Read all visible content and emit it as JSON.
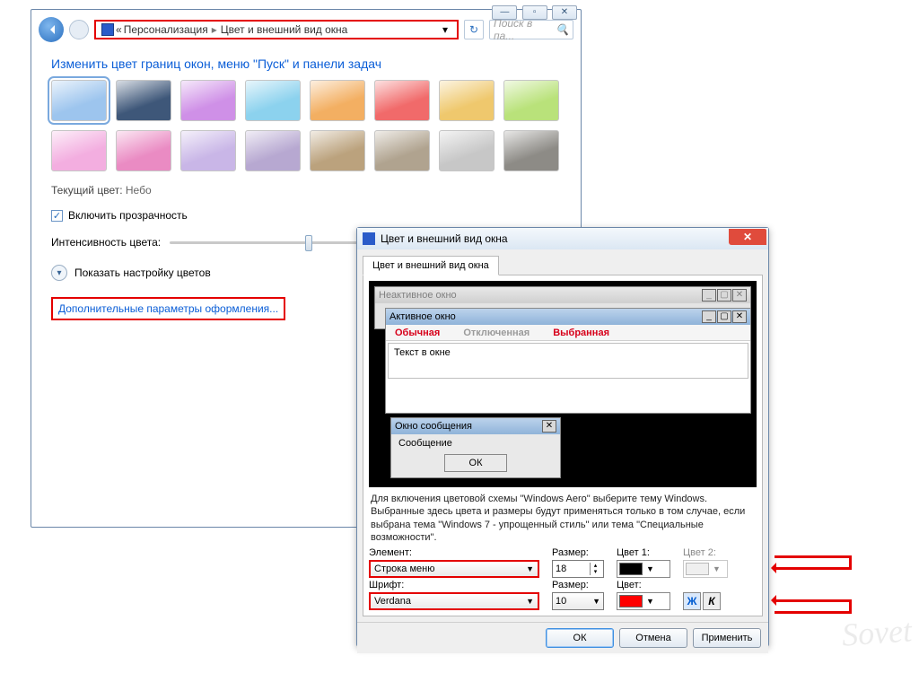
{
  "main_window": {
    "sys_buttons": {
      "min": "—",
      "max": "▫",
      "close": "✕"
    },
    "breadcrumb": {
      "level1": "Персонализация",
      "level2": "Цвет и внешний вид окна",
      "marker": "«"
    },
    "search_placeholder": "Поиск в па...",
    "heading": "Изменить цвет границ окон, меню \"Пуск\" и панели задач",
    "colors": [
      "#9dc5ee",
      "#3e5779",
      "#cf90e7",
      "#8cd2ee",
      "#f3af62",
      "#f16a6a",
      "#efc86d",
      "#b9e27a",
      "#f3aee0",
      "#ea8bc3",
      "#c9b6e7",
      "#b7a8d1",
      "#bba27d",
      "#b0a38f",
      "#c7c7c7",
      "#8d8b86"
    ],
    "current_color_label": "Текущий цвет:",
    "current_color_value": "Небо",
    "transparency_label": "Включить прозрачность",
    "intensity_label": "Интенсивность цвета:",
    "show_mixer_label": "Показать настройку цветов",
    "advanced_link": "Дополнительные параметры оформления..."
  },
  "dialog": {
    "title": "Цвет и внешний вид окна",
    "tab": "Цвет и внешний вид окна",
    "preview": {
      "inactive_title": "Неактивное окно",
      "active_title": "Активное окно",
      "menu_normal": "Обычная",
      "menu_disabled": "Отключенная",
      "menu_selected": "Выбранная",
      "body_text": "Текст в окне",
      "msg_title": "Окно сообщения",
      "msg_body": "Сообщение",
      "ok": "ОК"
    },
    "note": "Для включения цветовой схемы \"Windows Aero\" выберите тему Windows. Выбранные здесь цвета и размеры будут применяться только в том случае, если выбрана тема \"Windows 7 - упрощенный стиль\" или тема \"Специальные возможности\".",
    "labels": {
      "element": "Элемент:",
      "size": "Размер:",
      "color1": "Цвет 1:",
      "color2": "Цвет 2:",
      "font": "Шрифт:",
      "font_size": "Размер:",
      "font_color": "Цвет:"
    },
    "values": {
      "element": "Строка меню",
      "size": "18",
      "font": "Verdana",
      "font_size": "10",
      "color1": "#000000",
      "font_color": "#ff0000"
    },
    "bold_btn": "Ж",
    "italic_btn": "К",
    "buttons": {
      "ok": "ОК",
      "cancel": "Отмена",
      "apply": "Применить"
    }
  },
  "watermark": "Sovet"
}
